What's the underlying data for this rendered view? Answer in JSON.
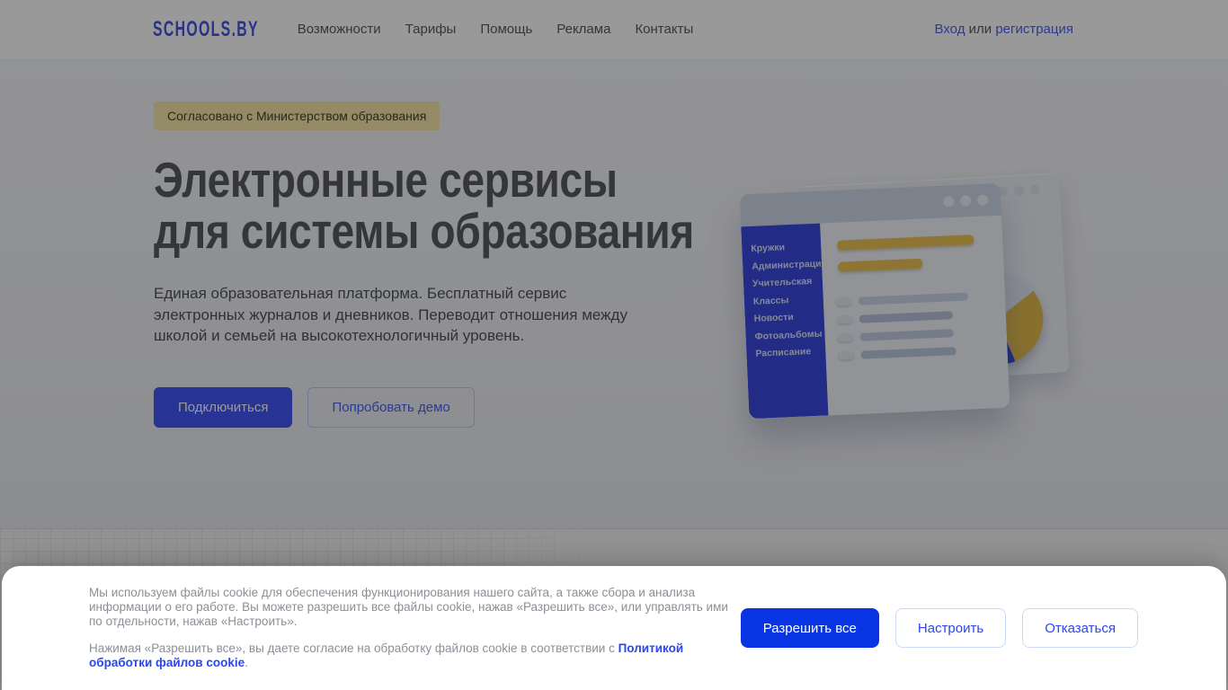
{
  "header": {
    "logo": "SCHOOLS.BY",
    "nav": {
      "items": [
        {
          "label": "Возможности"
        },
        {
          "label": "Тарифы"
        },
        {
          "label": "Помощь"
        },
        {
          "label": "Реклама"
        },
        {
          "label": "Контакты"
        }
      ]
    },
    "auth": {
      "login": "Вход",
      "separator": " или ",
      "register": "регистрация"
    }
  },
  "hero": {
    "badge": "Согласовано с Министерством образования",
    "title_line1": "Электронные сервисы",
    "title_line2": "для системы образования",
    "description": "Единая образовательная платформа. Бесплатный сервис электронных журналов и дневников. Переводит отношения между школой и семьей на высокотехнологичный уровень.",
    "connect_button": "Подключиться",
    "demo_button": "Попробовать демо"
  },
  "illustration": {
    "menu": [
      "Кружки",
      "Администрация",
      "Учительская",
      "Классы",
      "Новости",
      "Фотоальбомы",
      "Расписание"
    ]
  },
  "cookie_banner": {
    "paragraph1": "Мы используем файлы cookie для обеспечения функционирования нашего сайта, а также сбора и анализа информации о его работе. Вы можете разрешить все файлы cookie, нажав «Разрешить все», или управлять ими по отдельности, нажав «Настроить».",
    "paragraph2_prefix": "Нажимая «Разрешить все», вы даете согласие на обработку файлов cookie в соответствии с ",
    "policy_link": "Политикой обработки файлов cookie",
    "paragraph2_suffix": ".",
    "allow_button": "Разрешить все",
    "configure_button": "Настроить",
    "decline_button": "Отказаться"
  },
  "colors": {
    "cookie_accent_blue": "#0834E4",
    "hero_button_blue": "#4357F5",
    "sidebar_blue": "#3949E0",
    "badge_yellow": "#F7E7A9",
    "chart_yellow": "#EDC455",
    "pie_blue": "#2E46E0"
  }
}
